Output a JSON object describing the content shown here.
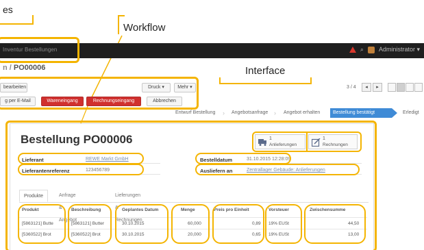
{
  "callouts": {
    "top_left_fragment": "es",
    "workflow": "Workflow",
    "interface": "Interface"
  },
  "topbar": {
    "menu_text": "Inventur   Bestellungen",
    "user": "Administrator ▾",
    "colors": {
      "bar": "#1f1f1f",
      "alert": "#d9372c"
    }
  },
  "breadcrumb": {
    "prefix": "n / ",
    "current": "PO00006"
  },
  "toolbar": {
    "left_button": "bearbeiten",
    "print": "Druck ▾",
    "more": "Mehr ▾",
    "pager": "3 / 4"
  },
  "workflow_buttons": {
    "email": "g per E-Mail",
    "receipt": "Wareneingang",
    "invoice": "Rechnungseingang",
    "cancel": "Abbrechen"
  },
  "stepper": {
    "steps": [
      "Entwurf Bestellung",
      "Angebotsanfrage",
      "Angebot erhalten",
      "Bestellung bestätigt",
      "Erledigt"
    ],
    "active_index": 3,
    "active_color": "#3f8bd6"
  },
  "form": {
    "title": "Bestellung PO00006",
    "smart_buttons": [
      {
        "count": "1",
        "label": "Anlieferungen",
        "icon": "truck-icon"
      },
      {
        "count": "1",
        "label": "Rechnungen",
        "icon": "invoice-edit-icon"
      }
    ],
    "fields": {
      "supplier_label": "Lieferant",
      "supplier_value": "REWE Markt GmbH",
      "ref_label": "Lieferantenreferenz",
      "ref_value": "123456789",
      "date_label": "Bestelldatum",
      "date_value": "31.10.2015 12:28:09",
      "deliver_label": "Ausliefern an",
      "deliver_value": "Zentrallager Gebäude: Anlieferungen"
    },
    "tabs": [
      "Produkte",
      "Anfrage & Angebot",
      "Lieferungen & Rechnungen"
    ],
    "table": {
      "headers": [
        "Produkt",
        "Beschreibung",
        "Geplantes Datum",
        "Menge",
        "Preis pro Einheit",
        "Vorsteuer",
        "Zwischensumme"
      ],
      "rows": [
        [
          "[5863121] Butte",
          "[5863121] Butter",
          "30.10.2015",
          "60,000",
          "0,89",
          "19% EUSt",
          "44,50"
        ],
        [
          "[5360522] Brot",
          "[5360522] Brot",
          "30.10.2015",
          "20,000",
          "0,65",
          "19% EUSt",
          "13,00"
        ]
      ]
    }
  }
}
